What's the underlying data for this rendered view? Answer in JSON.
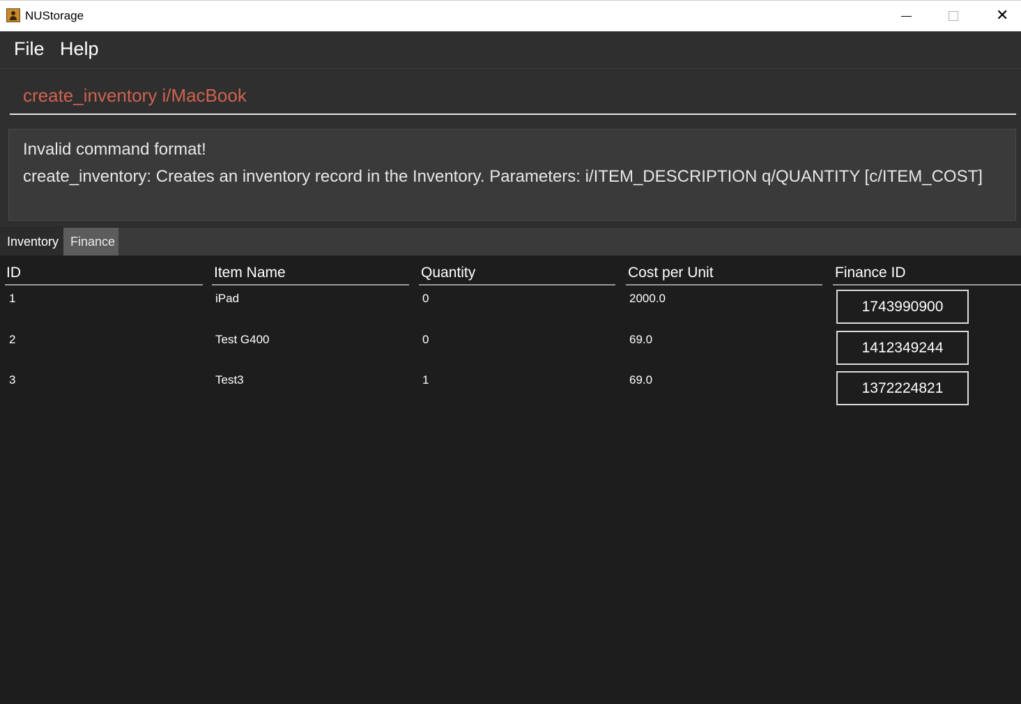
{
  "window": {
    "title": "NUStorage",
    "controls": {
      "minimize": "minimize",
      "maximize": "maximize",
      "close": "close"
    }
  },
  "menu": {
    "items": [
      "File",
      "Help"
    ]
  },
  "command": {
    "value": "create_inventory i/MacBook"
  },
  "result": {
    "lines": [
      "Invalid command format!",
      "create_inventory: Creates an inventory record in the Inventory. Parameters: i/ITEM_DESCRIPTION q/QUANTITY [c/ITEM_COST]"
    ]
  },
  "tabs": [
    {
      "label": "Inventory",
      "selected": true
    },
    {
      "label": "Finance",
      "selected": false
    }
  ],
  "table": {
    "columns": [
      "ID",
      "Item Name",
      "Quantity",
      "Cost per Unit",
      "Finance ID"
    ],
    "rows": [
      {
        "id": "1",
        "name": "iPad",
        "quantity": "0",
        "cost": "2000.0",
        "finance_id": "1743990900"
      },
      {
        "id": "2",
        "name": "Test G400",
        "quantity": "0",
        "cost": "69.0",
        "finance_id": "1412349244"
      },
      {
        "id": "3",
        "name": "Test3",
        "quantity": "1",
        "cost": "69.0",
        "finance_id": "1372224821"
      }
    ]
  },
  "colors": {
    "background": "#1d1d1d",
    "panel": "#2f2f2f",
    "command_text": "#d0624f",
    "accent_icon": "#c88a2e"
  }
}
